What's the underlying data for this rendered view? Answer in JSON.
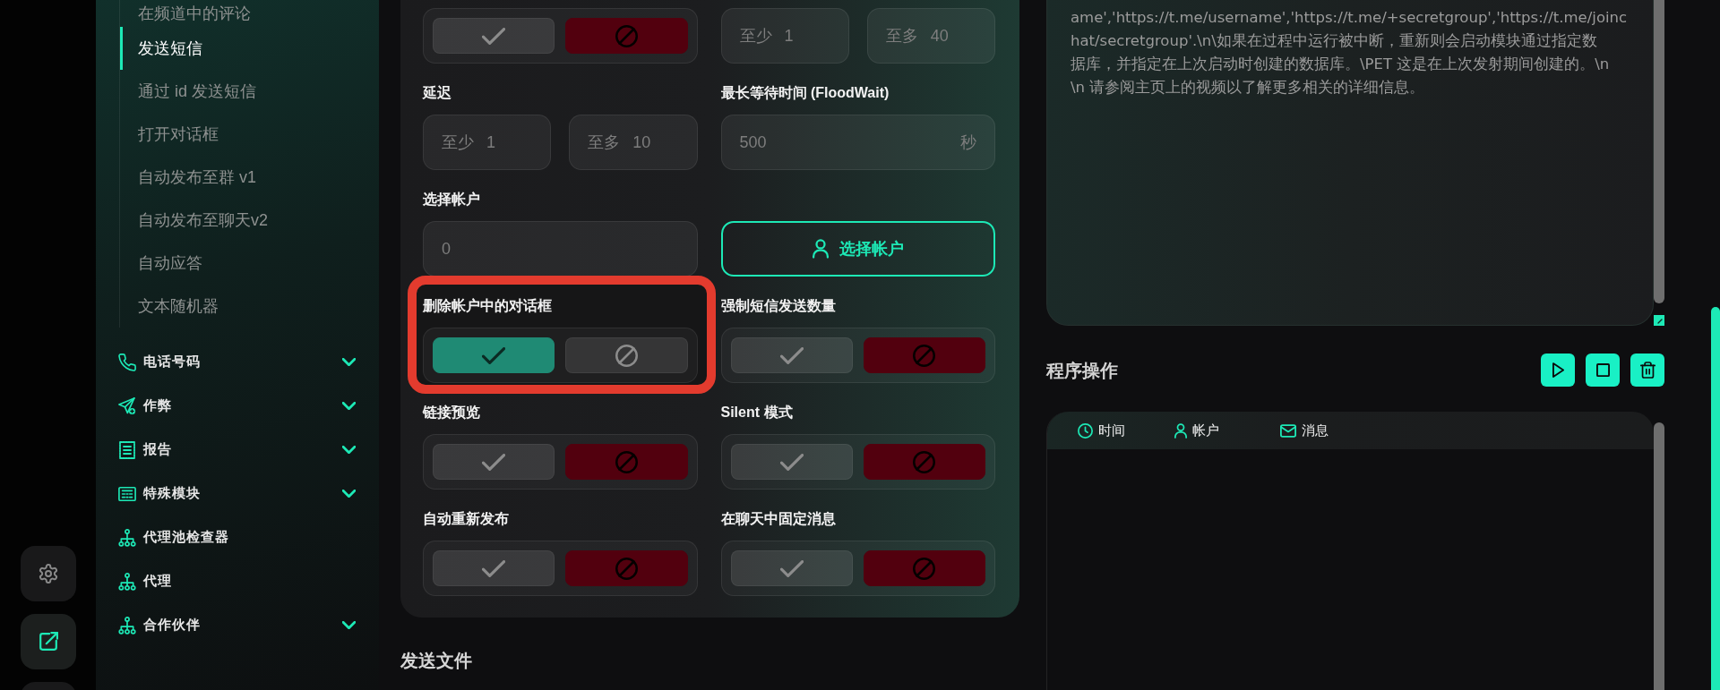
{
  "rail": [
    {
      "selected": false
    },
    {
      "selected": true
    }
  ],
  "sidebar": {
    "subitems": [
      {
        "label": "在频道中的评论",
        "selected": false
      },
      {
        "label": "发送短信",
        "selected": true
      },
      {
        "label": "通过 id 发送短信",
        "selected": false
      },
      {
        "label": "打开对话框",
        "selected": false
      },
      {
        "label": "自动发布至群 v1",
        "selected": false
      },
      {
        "label": "自动发布至聊天v2",
        "selected": false
      },
      {
        "label": "自动应答",
        "selected": false
      },
      {
        "label": "文本随机器",
        "selected": false
      }
    ],
    "groups": [
      {
        "label": "电话号码",
        "kind": "group"
      },
      {
        "label": "作弊",
        "kind": "group"
      },
      {
        "label": "报告",
        "kind": "group"
      },
      {
        "label": "特殊模块",
        "kind": "group"
      },
      {
        "label": "代理池检查器",
        "kind": "link"
      },
      {
        "label": "代理",
        "kind": "link"
      },
      {
        "label": "合作伙伴",
        "kind": "group"
      }
    ]
  },
  "settings_card": {
    "rows": [
      [
        {
          "kind": "toggle",
          "on": false,
          "highlighted": false
        },
        {
          "kind": "range",
          "inputs": [
            {
              "prefix": "至少",
              "value": "1"
            },
            {
              "prefix": "至多",
              "value": "40"
            }
          ]
        }
      ],
      [
        {
          "kind": "range",
          "label": "延迟",
          "inputs": [
            {
              "prefix": "至少",
              "value": "1"
            },
            {
              "prefix": "至多",
              "value": "10"
            }
          ]
        },
        {
          "kind": "input",
          "label": "最长等待时间 (FloodWait)",
          "value": "500",
          "suffix": "秒"
        }
      ],
      [
        {
          "kind": "input",
          "label": "选择帐户",
          "value": "0"
        },
        {
          "kind": "button",
          "text": "选择帐户"
        }
      ],
      [
        {
          "kind": "toggle",
          "label": "删除帐户中的对话框",
          "on": true,
          "highlighted": true
        },
        {
          "kind": "toggle",
          "label": "强制短信发送数量",
          "on": false,
          "highlighted": false
        }
      ],
      [
        {
          "kind": "toggle",
          "label": "链接预览",
          "on": false,
          "highlighted": false
        },
        {
          "kind": "toggle",
          "label": "Silent 模式",
          "on": false,
          "highlighted": false
        }
      ],
      [
        {
          "kind": "toggle",
          "label": "自动重新发布",
          "on": false,
          "highlighted": false
        },
        {
          "kind": "toggle",
          "label": "在聊天中固定消息",
          "on": false,
          "highlighted": false
        }
      ]
    ]
  },
  "send_files": {
    "title": "发送文件"
  },
  "message_box": {
    "lines": [
      "ame','https://t.me/username','https://t.me/+secretgroup','https://t.me/joinc",
      "hat/secretgroup'.\\n\\如果在过程中运行被中断，重新则会启动模块通过指定数",
      "据库，并指定在上次启动时创建的数据库。\\PET 这是在上次发射期间创建的。\\n",
      "\\n 请参阅主页上的视频以了解更多相关的详细信息。"
    ]
  },
  "program_actions": {
    "title": "程序操作",
    "log_columns": [
      {
        "label": "时间"
      },
      {
        "label": "帐户"
      },
      {
        "label": "消息"
      }
    ]
  }
}
